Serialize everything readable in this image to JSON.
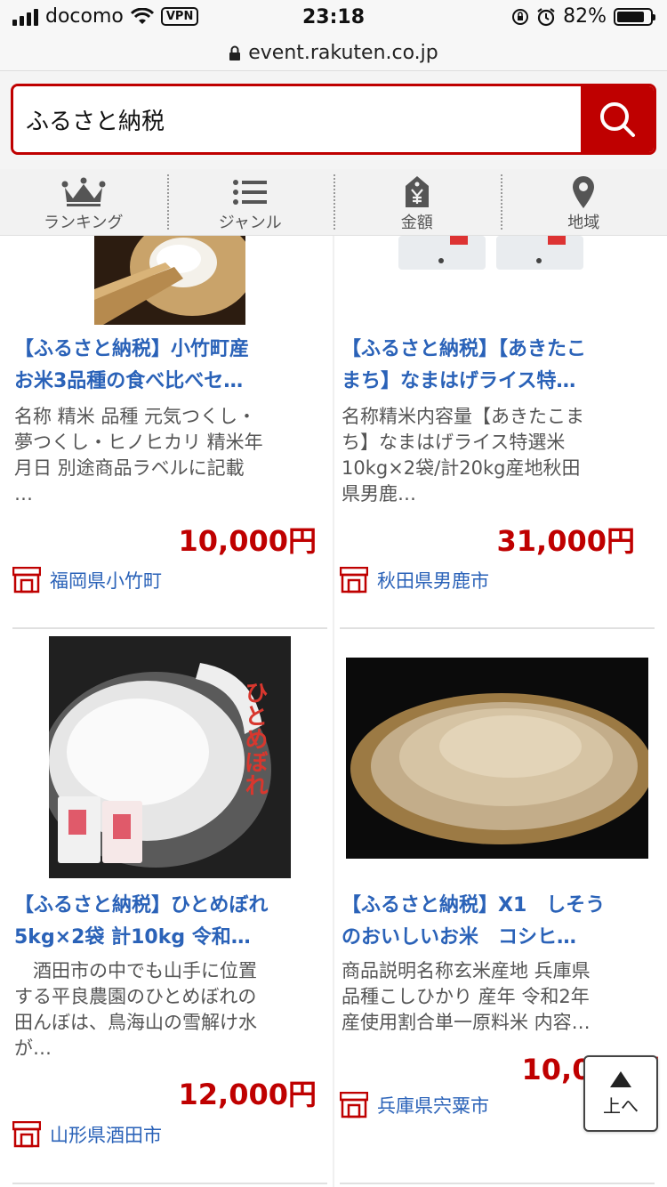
{
  "status_bar": {
    "carrier": "docomo",
    "vpn": "VPN",
    "time": "23:18",
    "battery": "82%"
  },
  "url_bar": {
    "url": "event.rakuten.co.jp"
  },
  "search": {
    "value": "ふるさと納税"
  },
  "nav": {
    "items": [
      {
        "label": "ランキング",
        "icon": "crown-icon"
      },
      {
        "label": "ジャンル",
        "icon": "list-icon"
      },
      {
        "label": "金額",
        "icon": "yen-tag-icon"
      },
      {
        "label": "地域",
        "icon": "map-pin-icon"
      }
    ]
  },
  "products": [
    {
      "title_line1": "【ふるさと納税】小竹町産",
      "title_line2": "お米3品種の食べ比べセ…",
      "desc_line1": "名称 精米 品種 元気つくし・",
      "desc_line2": "夢つくし・ヒノヒカリ 精米年",
      "desc_line3": "月日 別途商品ラベルに記載",
      "desc_line4": "…",
      "price": "10,000円",
      "location": "福岡県小竹町"
    },
    {
      "title_line1": "【ふるさと納税】【あきたこ",
      "title_line2": "まち】なまはげライス特…",
      "desc_line1": "名称精米内容量【あきたこま",
      "desc_line2": "ち】なまはげライス特選米",
      "desc_line3": "10kg×2袋/計20kg産地秋田",
      "desc_line4": "県男鹿…",
      "price": "31,000円",
      "location": "秋田県男鹿市"
    },
    {
      "title_line1": "【ふるさと納税】ひとめぼれ",
      "title_line2": "5kg×2袋 計10kg 令和…",
      "desc_line1": "　酒田市の中でも山手に位置",
      "desc_line2": "する平良農園のひとめぼれの",
      "desc_line3": "田んぼは、鳥海山の雪解け水",
      "desc_line4": "が…",
      "price": "12,000円",
      "location": "山形県酒田市",
      "image_text": "ひとめぼれ"
    },
    {
      "title_line1": "【ふるさと納税】X1　しそう",
      "title_line2": "のおいしいお米　コシヒ…",
      "desc_line1": "商品説明名称玄米産地 兵庫県",
      "desc_line2": "品種こしひかり 産年 令和2年",
      "desc_line3": "産使用割合単一原料米 内容…",
      "desc_line4": "",
      "price": "10,000円",
      "location": "兵庫県宍粟市"
    }
  ],
  "back_to_top": {
    "label": "上へ"
  },
  "colors": {
    "brand": "#bf0000",
    "link": "#2a62b8"
  }
}
